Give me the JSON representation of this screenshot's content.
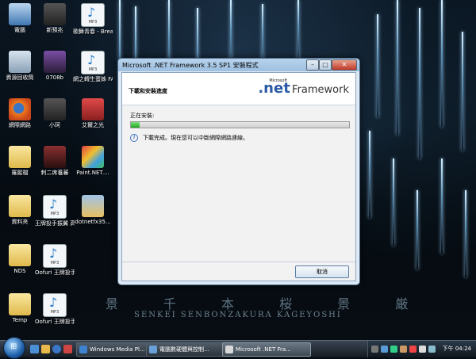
{
  "desktop": {
    "icons": [
      {
        "label": "電腦",
        "name": "desktop-icon-computer"
      },
      {
        "label": "新預兆",
        "name": "desktop-icon-figure-1"
      },
      {
        "label": "歌舞青春 - Breaking F...",
        "name": "desktop-icon-mp3-1"
      },
      {
        "label": "資源回收筒",
        "name": "desktop-icon-recycle-bin"
      },
      {
        "label": "0708b",
        "name": "desktop-icon-0708b"
      },
      {
        "label": "網之轉生蛋姊 FA-OP-YUI...",
        "name": "desktop-icon-mp3-2"
      },
      {
        "label": "網際網路",
        "name": "desktop-icon-firefox"
      },
      {
        "label": "小珂",
        "name": "desktop-icon-figure-2"
      },
      {
        "label": "艾爾之光",
        "name": "desktop-icon-elsword"
      },
      {
        "label": "羅蹤檔",
        "name": "desktop-icon-folder-1"
      },
      {
        "label": "刺二席養蕃",
        "name": "desktop-icon-figure-3"
      },
      {
        "label": "Paint.NET....",
        "name": "desktop-icon-paintnet"
      },
      {
        "label": "資料夾",
        "name": "desktop-icon-folder-2"
      },
      {
        "label": "王牌投手振翼 高揚 - OP",
        "name": "desktop-icon-mp3-3"
      },
      {
        "label": "dotnetfx35...",
        "name": "desktop-icon-dotnetfx"
      },
      {
        "label": "NDS",
        "name": "desktop-icon-nds"
      },
      {
        "label": "Oofuri 王牌投手-高揚...",
        "name": "desktop-icon-mp3-4"
      },
      {
        "label": "Temp",
        "name": "desktop-icon-temp"
      },
      {
        "label": "Oofuri 王牌投手-高揚...",
        "name": "desktop-icon-mp3-5"
      }
    ],
    "wallpaper_title": "殲 景 千 本 桜 景 厳",
    "wallpaper_subtitle": "SENKEI SENBONZAKURA KAGEYOSHI"
  },
  "dialog": {
    "title": "Microsoft .NET Framework 3.5 SP1 安裝程式",
    "minimize": "–",
    "maximize": "□",
    "close": "✕",
    "header_title": "下載和安裝進度",
    "logo_ms": "Microsoft",
    "logo_net": ".net",
    "logo_framework": "Framework",
    "install_label": "正在安裝:",
    "progress": 0.04,
    "status_text": "下載完成。現在您可以中斷網際網路連線。",
    "cancel_label": "取消"
  },
  "taskbar": {
    "start_glyph": "⊞",
    "tasks": [
      {
        "label": "Windows Media Pl...",
        "active": false
      },
      {
        "label": "電腦數硬體與控制...",
        "active": false
      },
      {
        "label": "Microsoft .NET Fra...",
        "active": true
      }
    ],
    "clock": "下午 04:24"
  },
  "colors": {
    "progress_fill": "#1ea81e",
    "taskbar": "#1f2730",
    "dialog_frame": "#b8d3ec"
  }
}
